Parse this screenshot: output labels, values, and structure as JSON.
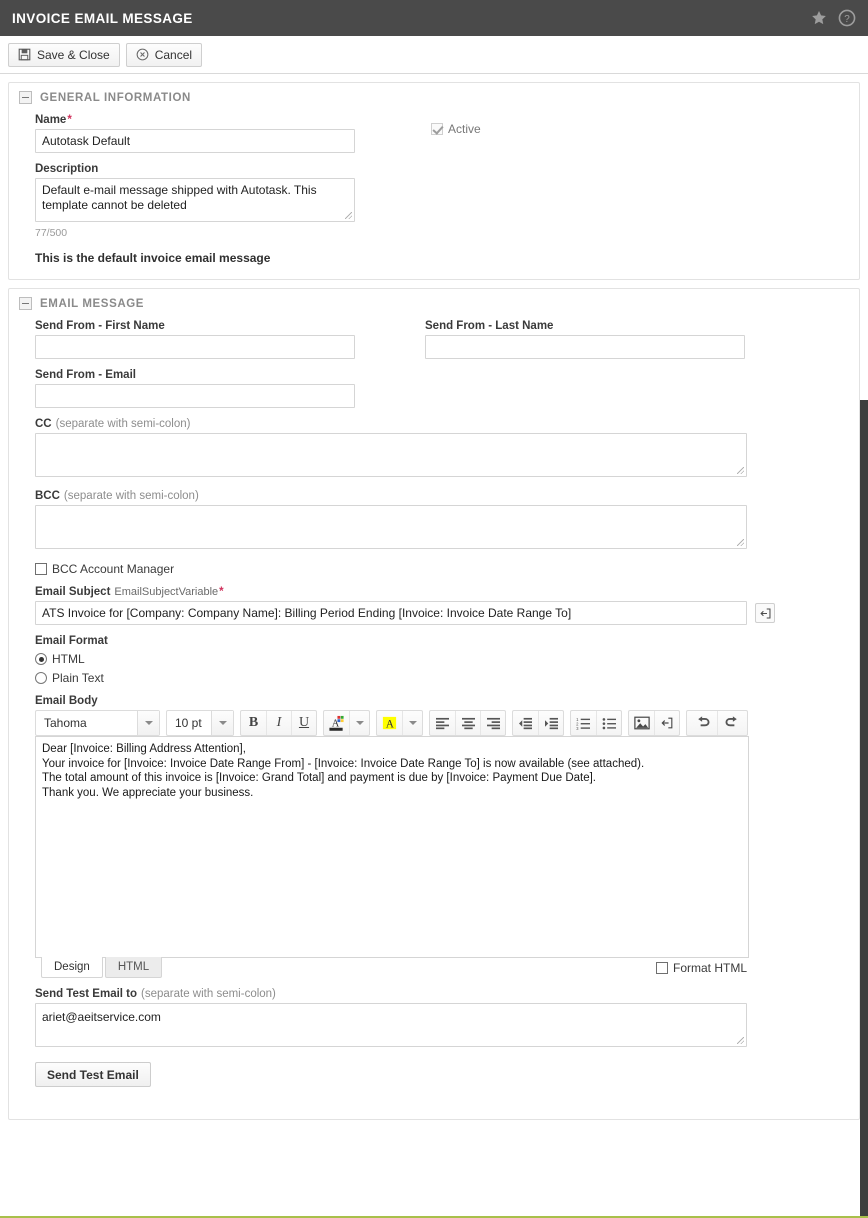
{
  "titlebar": {
    "title": "INVOICE EMAIL MESSAGE",
    "favorite_icon": "star-icon",
    "help_icon": "help-icon"
  },
  "toolbar": {
    "save_close_label": "Save & Close",
    "cancel_label": "Cancel",
    "save_icon": "save-disk-icon",
    "cancel_icon": "cancel-circle-icon"
  },
  "general_information": {
    "section_title": "GENERAL INFORMATION",
    "name_label": "Name",
    "name_required": "*",
    "name_value": "Autotask Default",
    "active_label": "Active",
    "active_checked": true,
    "description_label": "Description",
    "description_value": "Default e-mail message shipped with Autotask. This template cannot be deleted",
    "description_counter": "77/500",
    "note": "This is the default invoice email message"
  },
  "email_message": {
    "section_title": "EMAIL MESSAGE",
    "send_from_first_name_label": "Send From - First Name",
    "send_from_first_name_value": "",
    "send_from_last_name_label": "Send From - Last Name",
    "send_from_last_name_value": "",
    "send_from_email_label": "Send From - Email",
    "send_from_email_value": "",
    "cc_label": "CC",
    "cc_hint": "(separate with semi-colon)",
    "cc_value": "",
    "bcc_label": "BCC",
    "bcc_hint": "(separate with semi-colon)",
    "bcc_value": "",
    "bcc_account_manager_label": "BCC Account Manager",
    "bcc_account_manager_checked": false,
    "email_subject_label": "Email Subject",
    "email_subject_variable": "EmailSubjectVariable",
    "email_subject_required": "*",
    "email_subject_value": "ATS Invoice for [Company: Company Name]: Billing Period Ending [Invoice: Invoice Date Range To]",
    "insert_variable_icon": "insert-variable-icon",
    "email_format_label": "Email Format",
    "email_format_options": [
      "HTML",
      "Plain Text"
    ],
    "email_format_selected": "HTML",
    "email_body_label": "Email Body"
  },
  "editor": {
    "font_family_value": "Tahoma",
    "font_size_value": "10 pt",
    "buttons": [
      {
        "name": "bold-icon",
        "label": "B"
      },
      {
        "name": "italic-icon",
        "label": "I"
      },
      {
        "name": "underline-icon",
        "label": "U"
      },
      {
        "name": "font-color-icon",
        "label": "A"
      },
      {
        "name": "font-color-dropdown-icon",
        "label": ""
      },
      {
        "name": "highlight-color-icon",
        "label": "A"
      },
      {
        "name": "highlight-color-dropdown-icon",
        "label": ""
      },
      {
        "name": "align-left-icon",
        "label": ""
      },
      {
        "name": "align-center-icon",
        "label": ""
      },
      {
        "name": "align-right-icon",
        "label": ""
      },
      {
        "name": "outdent-icon",
        "label": ""
      },
      {
        "name": "indent-icon",
        "label": ""
      },
      {
        "name": "numbered-list-icon",
        "label": ""
      },
      {
        "name": "bulleted-list-icon",
        "label": ""
      },
      {
        "name": "insert-image-icon",
        "label": ""
      },
      {
        "name": "insert-variable-icon",
        "label": ""
      },
      {
        "name": "undo-icon",
        "label": ""
      },
      {
        "name": "redo-icon",
        "label": ""
      }
    ],
    "body_lines": [
      "Dear [Invoice: Billing Address Attention],",
      "Your invoice for [Invoice: Invoice Date Range From] - [Invoice: Invoice Date Range To] is now available (see attached).",
      "The total amount of this invoice is [Invoice: Grand Total] and payment is due by [Invoice: Payment Due Date].",
      "Thank you. We appreciate your business."
    ],
    "tabs": [
      {
        "label": "Design",
        "active": true
      },
      {
        "label": "HTML",
        "active": false
      }
    ],
    "format_html_label": "Format HTML",
    "format_html_checked": false
  },
  "send_test": {
    "label": "Send Test Email to",
    "hint": "(separate with semi-colon)",
    "value": "ariet@aeitservice.com",
    "button_label": "Send Test Email"
  },
  "colors": {
    "titlebar_bg": "#4a4a4a",
    "required_asterisk": "#d0315c",
    "section_title": "#8a8a8a",
    "footer_accent": "#a8bf4a",
    "highlight_yellow": "#ffff00"
  }
}
